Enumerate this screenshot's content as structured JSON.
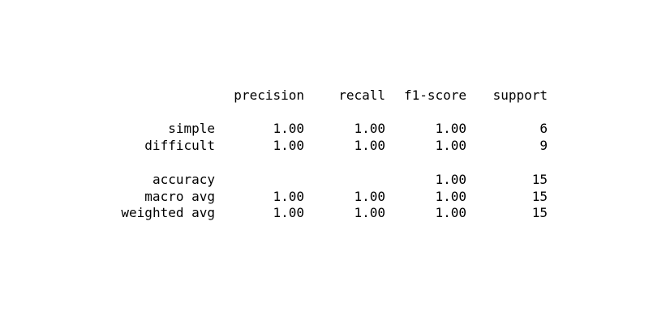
{
  "chart_data": {
    "type": "table",
    "title": "",
    "columns": [
      "precision",
      "recall",
      "f1-score",
      "support"
    ],
    "rows": [
      {
        "label": "simple",
        "values": [
          "1.00",
          "1.00",
          "1.00",
          "6"
        ]
      },
      {
        "label": "difficult",
        "values": [
          "1.00",
          "1.00",
          "1.00",
          "9"
        ]
      },
      {
        "label": "accuracy",
        "values": [
          "",
          "",
          "1.00",
          "15"
        ]
      },
      {
        "label": "macro avg",
        "values": [
          "1.00",
          "1.00",
          "1.00",
          "15"
        ]
      },
      {
        "label": "weighted avg",
        "values": [
          "1.00",
          "1.00",
          "1.00",
          "15"
        ]
      }
    ]
  }
}
